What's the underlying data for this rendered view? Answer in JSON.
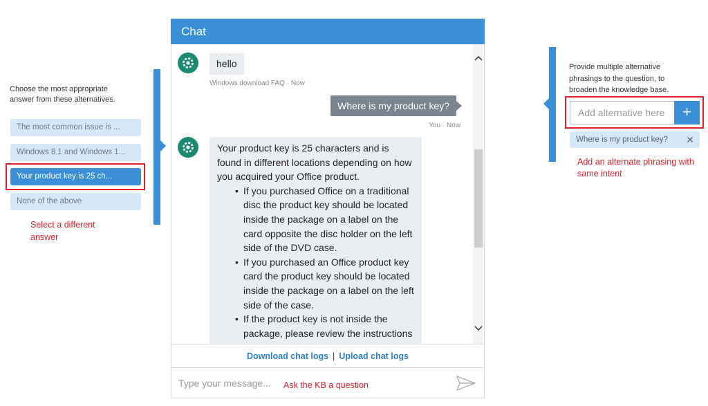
{
  "left_panel": {
    "instruction": "Choose the most appropriate answer from these alternatives.",
    "alternatives": [
      "The most common issue is ...",
      "Windows 8.1 and Windows 1...",
      "Your product key is 25 ch...",
      "None of the above"
    ],
    "selected_index": 2,
    "note": "Select a different answer"
  },
  "chat": {
    "title": "Chat",
    "messages": {
      "bot_hello": "hello",
      "bot_hello_meta": "Windows download FAQ · Now",
      "user_question": "Where is my product key?",
      "user_meta": "You · Now",
      "bot_answer_intro": "Your product key is 25 characters and is found in different locations depending on how you acquired your Office product.",
      "bot_answer_bullets": [
        "If you purchased Office on a traditional disc the product key should be located inside the package on a label on the card opposite the disc holder on the left side of the DVD case.",
        "If you purchased an Office product key card the product key should be located inside the package on a label on the left side of the case.",
        "If the product key is not inside the package, please review the instructions"
      ]
    },
    "links": {
      "download": "Download chat logs",
      "separator": "|",
      "upload": "Upload chat logs"
    },
    "input_placeholder": "Type your message...",
    "input_note": "Ask the KB a question"
  },
  "right_panel": {
    "instruction": "Provide multiple alternative phrasings to the question, to broaden the knowledge base.",
    "input_placeholder": "Add alternative here",
    "add_button": "+",
    "tag_text": "Where is my product key?",
    "tag_close": "✕",
    "note": "Add an alternate phrasing with same intent"
  },
  "colors": {
    "accent": "#3a8fd6",
    "annotation_red": "#e0202a",
    "bot_avatar": "#1c8a73"
  }
}
